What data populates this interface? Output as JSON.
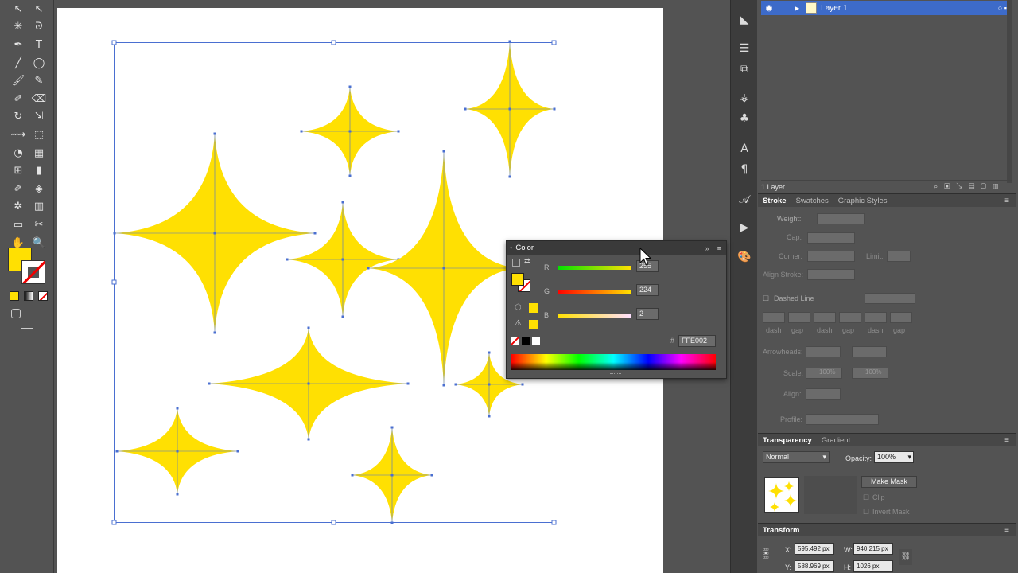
{
  "colors": {
    "fill": "#FFE002",
    "panel_bg": "#535353",
    "selection": "#4a6fd1",
    "layer_highlight": "#3d6bc9"
  },
  "tools": {
    "icons": [
      "selection-icon",
      "direct-selection-icon",
      "magic-wand-icon",
      "lasso-icon",
      "pen-icon",
      "type-icon",
      "line-icon",
      "ellipse-icon",
      "paintbrush-icon",
      "pencil-icon",
      "blob-brush-icon",
      "eraser-icon",
      "rotate-icon",
      "scale-icon",
      "width-icon",
      "free-transform-icon",
      "shape-builder-icon",
      "perspective-icon",
      "mesh-icon",
      "gradient-icon",
      "eyedropper-icon",
      "blend-icon",
      "symbol-sprayer-icon",
      "column-graph-icon",
      "artboard-icon",
      "slice-icon",
      "hand-icon",
      "zoom-icon"
    ],
    "glyphs": [
      "↖",
      "↖",
      "✳",
      "ᘐ",
      "✒",
      "T",
      "╱",
      "◯",
      "🖌",
      "✎",
      "✐",
      "⌫",
      "↻",
      "⇲",
      "⟿",
      "⬚",
      "◔",
      "▦",
      "⊞",
      "▮",
      "✐",
      "◈",
      "✲",
      "▥",
      "▭",
      "✂",
      "✋",
      "🔍"
    ]
  },
  "layers": {
    "layer_name": "Layer 1",
    "count_label": "1 Layer"
  },
  "stroke_panel": {
    "tabs": [
      "Stroke",
      "Swatches",
      "Graphic Styles"
    ],
    "weight_label": "Weight:",
    "cap_label": "Cap:",
    "corner_label": "Corner:",
    "limit_label": "Limit:",
    "align_stroke_label": "Align Stroke:",
    "dashed_line_label": "Dashed Line",
    "dash_labels": [
      "dash",
      "gap",
      "dash",
      "gap",
      "dash",
      "gap"
    ],
    "arrowheads_label": "Arrowheads:",
    "scale_label": "Scale:",
    "scale_values": [
      "100%",
      "100%"
    ],
    "align_label": "Align:",
    "profile_label": "Profile:"
  },
  "transparency_panel": {
    "tabs": [
      "Transparency",
      "Gradient"
    ],
    "blend_mode": "Normal",
    "opacity_label": "Opacity:",
    "opacity_value": "100%",
    "make_mask_label": "Make Mask",
    "clip_label": "Clip",
    "invert_mask_label": "Invert Mask"
  },
  "transform_panel": {
    "title": "Transform",
    "x_label": "X:",
    "x_value": "595.492 px",
    "y_label": "Y:",
    "y_value": "588.969 px",
    "w_label": "W:",
    "w_value": "940.215 px",
    "h_label": "H:",
    "h_value": "1026 px"
  },
  "color_panel": {
    "title": "Color",
    "r_label": "R",
    "g_label": "G",
    "b_label": "B",
    "r_value": "255",
    "g_value": "224",
    "b_value": "2",
    "hex_label": "#",
    "hex_value": "FFE002"
  }
}
